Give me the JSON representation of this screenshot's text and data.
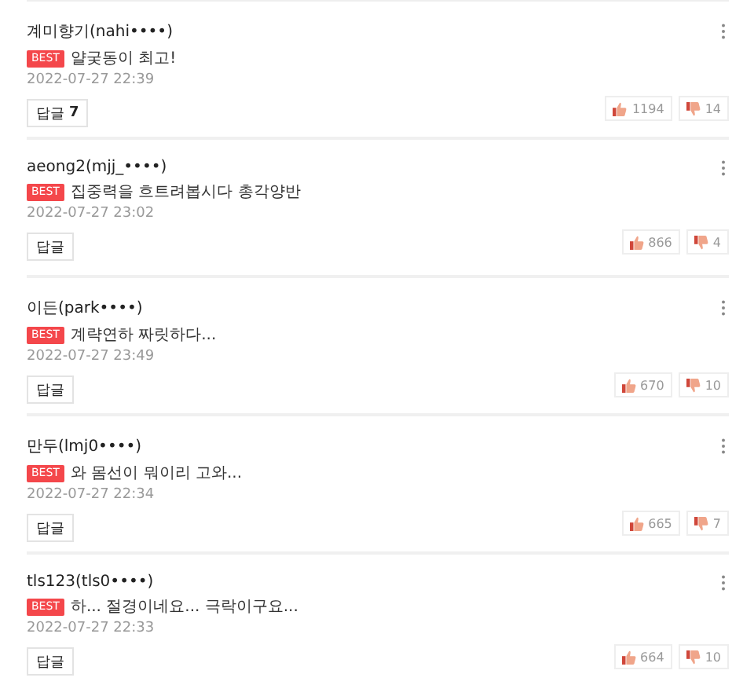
{
  "comments": [
    {
      "author": "계미향기(nahi••••)",
      "badge": "BEST",
      "text": "얄궂동이 최고!",
      "date": "2022-07-27 22:39",
      "reply": {
        "label": "답글",
        "count": "7"
      },
      "likes": "1194",
      "dislikes": "14"
    },
    {
      "author": "aeong2(mjj_••••)",
      "badge": "BEST",
      "text": "집중력을 흐트려봅시다 총각양반",
      "date": "2022-07-27 23:02",
      "reply": {
        "label": "답글"
      },
      "likes": "866",
      "dislikes": "4"
    },
    {
      "author": "이든(park••••)",
      "badge": "BEST",
      "text": "계략연하 짜릿하다...",
      "date": "2022-07-27 23:49",
      "reply": {
        "label": "답글"
      },
      "likes": "670",
      "dislikes": "10"
    },
    {
      "author": "만두(lmj0••••)",
      "badge": "BEST",
      "text": "와 몸선이 뭐이리 고와...",
      "date": "2022-07-27 22:34",
      "reply": {
        "label": "답글"
      },
      "likes": "665",
      "dislikes": "7"
    },
    {
      "author": "tls123(tls0••••)",
      "badge": "BEST",
      "text": "하... 절경이네요... 극락이구요...",
      "date": "2022-07-27 22:33",
      "reply": {
        "label": "답글"
      },
      "likes": "664",
      "dislikes": "10"
    }
  ]
}
